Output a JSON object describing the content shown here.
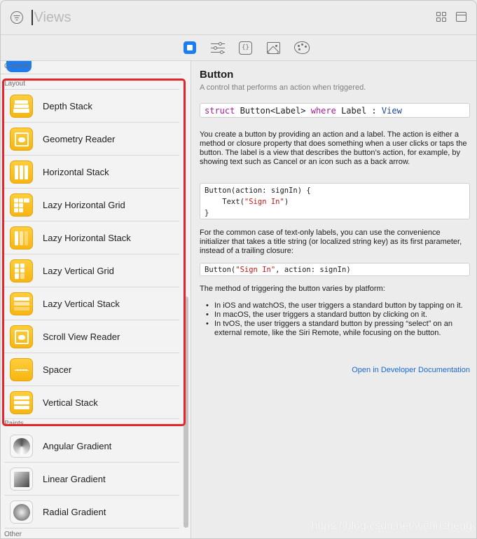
{
  "search": {
    "value": "",
    "placeholder": "Views"
  },
  "tabs": [
    {
      "name": "views",
      "icon": "views-icon",
      "active": true
    },
    {
      "name": "modifiers",
      "icon": "modifiers-icon",
      "active": false
    },
    {
      "name": "snippets",
      "icon": "snippets-icon",
      "active": false
    },
    {
      "name": "media",
      "icon": "media-icon",
      "active": false
    },
    {
      "name": "colors",
      "icon": "colors-icon",
      "active": false
    }
  ],
  "sidebar": {
    "sections": {
      "controls": "Controls",
      "layout": "Layout",
      "paints": "Paints",
      "other": "Other"
    },
    "layout_items": [
      {
        "label": "Depth Stack",
        "icon": "depth-stack-icon"
      },
      {
        "label": "Geometry Reader",
        "icon": "geometry-reader-icon"
      },
      {
        "label": "Horizontal Stack",
        "icon": "horizontal-stack-icon"
      },
      {
        "label": "Lazy Horizontal Grid",
        "icon": "lazy-horizontal-grid-icon"
      },
      {
        "label": "Lazy Horizontal Stack",
        "icon": "lazy-horizontal-stack-icon"
      },
      {
        "label": "Lazy Vertical Grid",
        "icon": "lazy-vertical-grid-icon"
      },
      {
        "label": "Lazy Vertical Stack",
        "icon": "lazy-vertical-stack-icon"
      },
      {
        "label": "Scroll View Reader",
        "icon": "scroll-view-reader-icon"
      },
      {
        "label": "Spacer",
        "icon": "spacer-icon"
      },
      {
        "label": "Vertical Stack",
        "icon": "vertical-stack-icon"
      }
    ],
    "paint_items": [
      {
        "label": "Angular Gradient",
        "icon": "angular-gradient-icon"
      },
      {
        "label": "Linear Gradient",
        "icon": "linear-gradient-icon"
      },
      {
        "label": "Radial Gradient",
        "icon": "radial-gradient-icon"
      }
    ]
  },
  "detail": {
    "title": "Button",
    "subtitle": "A control that performs an action when triggered.",
    "declaration": {
      "kw1": "struct",
      "type_sig": " Button<Label> ",
      "kw2": "where",
      "constraint": " Label : ",
      "proto": "View"
    },
    "para1": "You create a button by providing an action and a label. The action is either a method or closure property that does something when a user clicks or taps the button. The label is a view that describes the button’s action, for example, by showing text such as Cancel or an icon such as a back arrow.",
    "code1": {
      "line1": "Button(action: signIn) {",
      "line2_pre": "    Text(",
      "line2_str": "\"Sign In\"",
      "line2_post": ")",
      "line3": "}"
    },
    "para2": "For the common case of text-only labels, you can use the convenience initializer that takes a title string (or localized string key) as its first parameter, instead of a trailing closure:",
    "code2": {
      "pre": "Button(",
      "str": "\"Sign In\"",
      "post": ", action: signIn)"
    },
    "para3": "The method of triggering the button varies by platform:",
    "bullets": [
      "In iOS and watchOS, the user triggers a standard button by tapping on it.",
      "In macOS, the user triggers a standard button by clicking on it.",
      "In tvOS, the user triggers a standard button by pressing “select” on an external remote, like the Siri Remote, while focusing on the button."
    ],
    "link": "Open in Developer Documentation"
  },
  "watermark": "https://blog.csdn.net/wenrisheng",
  "colors": {
    "accent": "#1c7cf4",
    "icon_yellow": "#f9c11f",
    "highlight": "#e4262b",
    "keyword": "#a51a9c",
    "string": "#c41a16",
    "link": "#1a6ad6"
  }
}
